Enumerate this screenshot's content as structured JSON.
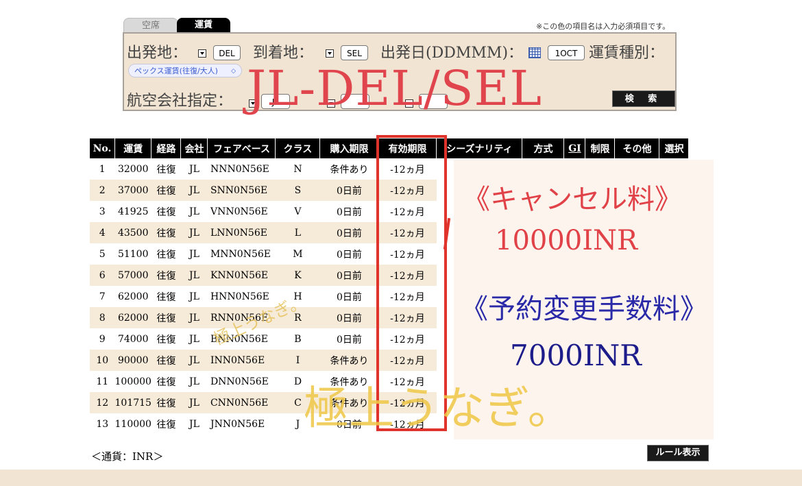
{
  "tabs": [
    {
      "label": "空席",
      "active": false
    },
    {
      "label": "運賃",
      "active": true
    }
  ],
  "required_note": "※この色の項目名は入力必須項目です。",
  "form": {
    "origin_label": "出発地：",
    "origin_value": "DEL",
    "destination_label": "到着地：",
    "destination_value": "SEL",
    "date_label": "出発日(DDMMM)：",
    "date_value": "1OCT",
    "fare_type_label": "運賃種別：",
    "fare_type_value": "ペックス運賃(往復/大人)",
    "airline_label": "航空会社指定：",
    "airline_value_1": "JL",
    "airline_value_2": "",
    "airline_value_3": "",
    "search_label": "検 索"
  },
  "overlay_title": "JL-DEL/SEL",
  "table": {
    "headers": [
      "No.",
      "運賃",
      "経路",
      "会社",
      "フェアベース",
      "クラス",
      "購入期限",
      "有効期限",
      "シーズナリティ",
      "方式",
      "GI",
      "制限",
      "その他",
      "選択"
    ],
    "rows": [
      [
        "1",
        "32000",
        "往復",
        "JL",
        "NNN0N56E",
        "N",
        "条件あり",
        "-12ヵ月"
      ],
      [
        "2",
        "37000",
        "往復",
        "JL",
        "SNN0N56E",
        "S",
        "0日前",
        "-12ヵ月"
      ],
      [
        "3",
        "41925",
        "往復",
        "JL",
        "VNN0N56E",
        "V",
        "0日前",
        "-12ヵ月"
      ],
      [
        "4",
        "43500",
        "往復",
        "JL",
        "LNN0N56E",
        "L",
        "0日前",
        "-12ヵ月"
      ],
      [
        "5",
        "51100",
        "往復",
        "JL",
        "MNN0N56E",
        "M",
        "0日前",
        "-12ヵ月"
      ],
      [
        "6",
        "57000",
        "往復",
        "JL",
        "KNN0N56E",
        "K",
        "0日前",
        "-12ヵ月"
      ],
      [
        "7",
        "62000",
        "往復",
        "JL",
        "HNN0N56E",
        "H",
        "0日前",
        "-12ヵ月"
      ],
      [
        "8",
        "62000",
        "往復",
        "JL",
        "RNN0N56E",
        "R",
        "0日前",
        "-12ヵ月"
      ],
      [
        "9",
        "74000",
        "往復",
        "JL",
        "BNN0N56E",
        "B",
        "0日前",
        "-12ヵ月"
      ],
      [
        "10",
        "90000",
        "往復",
        "JL",
        "INN0N56E",
        "I",
        "条件あり",
        "-12ヵ月"
      ],
      [
        "11",
        "100000",
        "往復",
        "JL",
        "DNN0N56E",
        "D",
        "条件あり",
        "-12ヵ月"
      ],
      [
        "12",
        "101715",
        "往復",
        "JL",
        "CNN0N56E",
        "C",
        "条件あり",
        "-12ヵ月"
      ],
      [
        "13",
        "110000",
        "往復",
        "JL",
        "JNN0N56E",
        "J",
        "0日前",
        "-12ヵ月"
      ]
    ]
  },
  "annotations": {
    "cancel_heading": "《キャンセル料》",
    "cancel_value": "10000INR",
    "change_heading": "《予約変更手数料》",
    "change_value": "7000INR",
    "watermark_small": "極上うなぎ。",
    "watermark_big": "極上うなぎ。"
  },
  "currency_note": "＜通貨：INR＞",
  "rule_button": "ルール表示",
  "colors": {
    "accent_red": "#e0332b",
    "form_bg": "#f2e4d2",
    "row_alt": "#f6ead9",
    "header_bg": "#000000",
    "change_blue": "#2a2aa8",
    "watermark_gold": "#efc84a"
  }
}
